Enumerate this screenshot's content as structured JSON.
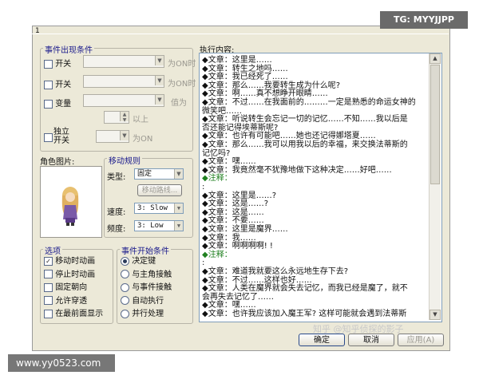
{
  "watermark_top": "TG: MYYJJPP",
  "watermark_bottom": "www.yy0523.com",
  "watermark_list": "知乎 @知乎侦探的影子",
  "tab_number": "1",
  "event_conditions": {
    "title": "事件出现条件",
    "switch1": {
      "label": "开关",
      "suffix": "为ON时"
    },
    "switch2": {
      "label": "开关",
      "suffix": "为ON时"
    },
    "variable": {
      "label": "变量",
      "suffix": "值为",
      "above": "以上"
    },
    "self_switch": {
      "label_line1": "独立",
      "label_line2": "开关",
      "suffix": "为ON"
    }
  },
  "character": {
    "label": "角色图片:"
  },
  "movement": {
    "title": "移动规则",
    "type_label": "类型:",
    "type_value": "固定",
    "route_button": "移动路线...",
    "speed_label": "速度:",
    "speed_value": "3: Slow",
    "freq_label": "频度:",
    "freq_value": "3: Low"
  },
  "options": {
    "title": "选项",
    "items": [
      {
        "label": "移动时动画",
        "checked": true
      },
      {
        "label": "停止时动画",
        "checked": false
      },
      {
        "label": "固定朝向",
        "checked": false
      },
      {
        "label": "允许穿透",
        "checked": false
      },
      {
        "label": "在最前面显示",
        "checked": false
      }
    ]
  },
  "trigger": {
    "title": "事件开始条件",
    "items": [
      {
        "label": "决定键",
        "checked": true
      },
      {
        "label": "与主角接触",
        "checked": false
      },
      {
        "label": "与事件接触",
        "checked": false
      },
      {
        "label": "自动执行",
        "checked": false
      },
      {
        "label": "并行处理",
        "checked": false
      }
    ]
  },
  "contents": {
    "label": "执行内容:",
    "lines": [
      {
        "tag": "◆文章",
        "text": "：这里是……"
      },
      {
        "tag": "◆文章",
        "text": "：转生之地吗……"
      },
      {
        "tag": "◆文章",
        "text": "：我已经死了……"
      },
      {
        "tag": "◆文章",
        "text": "：那么……我要转生成为什么呢?"
      },
      {
        "tag": "◆文章",
        "text": "：啊……真不想睁开眼睛……"
      },
      {
        "tag": "◆文章",
        "text": "：不过……在我面前的………一定是熟悉的命运女神的"
      },
      {
        "tag": "",
        "text": "  微笑吧……"
      },
      {
        "tag": "◆文章",
        "text": "：听说转生会忘记一切的记忆……不知……我以后是"
      },
      {
        "tag": "",
        "text": "  否还能记得埃蒂斯呢?"
      },
      {
        "tag": "◆文章",
        "text": "：也许有可能吧……她也还记得娜塔夏……"
      },
      {
        "tag": "◆文章",
        "text": "：那么……我可以用我以后的幸福，来交换法蒂斯的"
      },
      {
        "tag": "",
        "text": "  记忆吗?"
      },
      {
        "tag": "◆文章",
        "text": "：嘿……"
      },
      {
        "tag": "◆文章",
        "text": "：我竟然毫不犹豫地做下这种决定……好吧……"
      },
      {
        "tag": "◆注释",
        "text": "：",
        "green": true
      },
      {
        "tag": "",
        "text": "  :"
      },
      {
        "tag": "◆文章",
        "text": "：这里是……?"
      },
      {
        "tag": "◆文章",
        "text": "：这是……?"
      },
      {
        "tag": "◆文章",
        "text": "：这是……"
      },
      {
        "tag": "◆文章",
        "text": "：不要……"
      },
      {
        "tag": "◆文章",
        "text": "：这里是魔界……"
      },
      {
        "tag": "◆文章",
        "text": "：我……"
      },
      {
        "tag": "◆文章",
        "text": "：啊啊啊啊! !"
      },
      {
        "tag": "◆注释",
        "text": "：",
        "green": true
      },
      {
        "tag": "",
        "text": "  :"
      },
      {
        "tag": "◆文章",
        "text": "：难道我就要这么永远地生存下去?"
      },
      {
        "tag": "◆文章",
        "text": "：不过……这样也好……"
      },
      {
        "tag": "◆文章",
        "text": "：人类在魔界就会失去记忆，而我已经是魔了，就不"
      },
      {
        "tag": "",
        "text": "  会再失去记忆了……"
      },
      {
        "tag": "◆文章",
        "text": "：嘿……"
      },
      {
        "tag": "◆文章",
        "text": "：也许我应该加入魔王军? 这样可能就会遇到法蒂斯"
      }
    ]
  },
  "buttons": {
    "ok": "确定",
    "cancel": "取消",
    "apply": "应用(A)"
  }
}
